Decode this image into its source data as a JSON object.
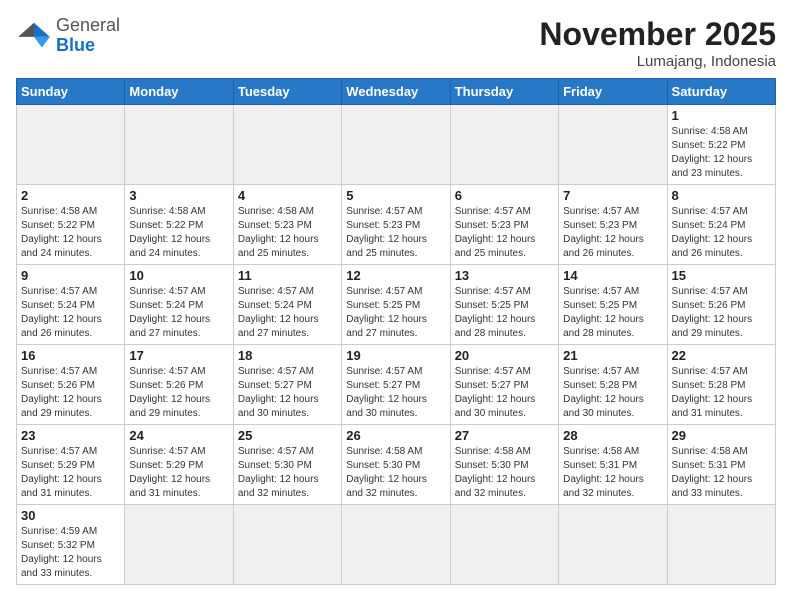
{
  "header": {
    "logo_general": "General",
    "logo_blue": "Blue",
    "month_title": "November 2025",
    "location": "Lumajang, Indonesia"
  },
  "weekdays": [
    "Sunday",
    "Monday",
    "Tuesday",
    "Wednesday",
    "Thursday",
    "Friday",
    "Saturday"
  ],
  "weeks": [
    [
      {
        "day": "",
        "info": ""
      },
      {
        "day": "",
        "info": ""
      },
      {
        "day": "",
        "info": ""
      },
      {
        "day": "",
        "info": ""
      },
      {
        "day": "",
        "info": ""
      },
      {
        "day": "",
        "info": ""
      },
      {
        "day": "1",
        "info": "Sunrise: 4:58 AM\nSunset: 5:22 PM\nDaylight: 12 hours\nand 23 minutes."
      }
    ],
    [
      {
        "day": "2",
        "info": "Sunrise: 4:58 AM\nSunset: 5:22 PM\nDaylight: 12 hours\nand 24 minutes."
      },
      {
        "day": "3",
        "info": "Sunrise: 4:58 AM\nSunset: 5:22 PM\nDaylight: 12 hours\nand 24 minutes."
      },
      {
        "day": "4",
        "info": "Sunrise: 4:58 AM\nSunset: 5:23 PM\nDaylight: 12 hours\nand 25 minutes."
      },
      {
        "day": "5",
        "info": "Sunrise: 4:57 AM\nSunset: 5:23 PM\nDaylight: 12 hours\nand 25 minutes."
      },
      {
        "day": "6",
        "info": "Sunrise: 4:57 AM\nSunset: 5:23 PM\nDaylight: 12 hours\nand 25 minutes."
      },
      {
        "day": "7",
        "info": "Sunrise: 4:57 AM\nSunset: 5:23 PM\nDaylight: 12 hours\nand 26 minutes."
      },
      {
        "day": "8",
        "info": "Sunrise: 4:57 AM\nSunset: 5:24 PM\nDaylight: 12 hours\nand 26 minutes."
      }
    ],
    [
      {
        "day": "9",
        "info": "Sunrise: 4:57 AM\nSunset: 5:24 PM\nDaylight: 12 hours\nand 26 minutes."
      },
      {
        "day": "10",
        "info": "Sunrise: 4:57 AM\nSunset: 5:24 PM\nDaylight: 12 hours\nand 27 minutes."
      },
      {
        "day": "11",
        "info": "Sunrise: 4:57 AM\nSunset: 5:24 PM\nDaylight: 12 hours\nand 27 minutes."
      },
      {
        "day": "12",
        "info": "Sunrise: 4:57 AM\nSunset: 5:25 PM\nDaylight: 12 hours\nand 27 minutes."
      },
      {
        "day": "13",
        "info": "Sunrise: 4:57 AM\nSunset: 5:25 PM\nDaylight: 12 hours\nand 28 minutes."
      },
      {
        "day": "14",
        "info": "Sunrise: 4:57 AM\nSunset: 5:25 PM\nDaylight: 12 hours\nand 28 minutes."
      },
      {
        "day": "15",
        "info": "Sunrise: 4:57 AM\nSunset: 5:26 PM\nDaylight: 12 hours\nand 29 minutes."
      }
    ],
    [
      {
        "day": "16",
        "info": "Sunrise: 4:57 AM\nSunset: 5:26 PM\nDaylight: 12 hours\nand 29 minutes."
      },
      {
        "day": "17",
        "info": "Sunrise: 4:57 AM\nSunset: 5:26 PM\nDaylight: 12 hours\nand 29 minutes."
      },
      {
        "day": "18",
        "info": "Sunrise: 4:57 AM\nSunset: 5:27 PM\nDaylight: 12 hours\nand 30 minutes."
      },
      {
        "day": "19",
        "info": "Sunrise: 4:57 AM\nSunset: 5:27 PM\nDaylight: 12 hours\nand 30 minutes."
      },
      {
        "day": "20",
        "info": "Sunrise: 4:57 AM\nSunset: 5:27 PM\nDaylight: 12 hours\nand 30 minutes."
      },
      {
        "day": "21",
        "info": "Sunrise: 4:57 AM\nSunset: 5:28 PM\nDaylight: 12 hours\nand 30 minutes."
      },
      {
        "day": "22",
        "info": "Sunrise: 4:57 AM\nSunset: 5:28 PM\nDaylight: 12 hours\nand 31 minutes."
      }
    ],
    [
      {
        "day": "23",
        "info": "Sunrise: 4:57 AM\nSunset: 5:29 PM\nDaylight: 12 hours\nand 31 minutes."
      },
      {
        "day": "24",
        "info": "Sunrise: 4:57 AM\nSunset: 5:29 PM\nDaylight: 12 hours\nand 31 minutes."
      },
      {
        "day": "25",
        "info": "Sunrise: 4:57 AM\nSunset: 5:30 PM\nDaylight: 12 hours\nand 32 minutes."
      },
      {
        "day": "26",
        "info": "Sunrise: 4:58 AM\nSunset: 5:30 PM\nDaylight: 12 hours\nand 32 minutes."
      },
      {
        "day": "27",
        "info": "Sunrise: 4:58 AM\nSunset: 5:30 PM\nDaylight: 12 hours\nand 32 minutes."
      },
      {
        "day": "28",
        "info": "Sunrise: 4:58 AM\nSunset: 5:31 PM\nDaylight: 12 hours\nand 32 minutes."
      },
      {
        "day": "29",
        "info": "Sunrise: 4:58 AM\nSunset: 5:31 PM\nDaylight: 12 hours\nand 33 minutes."
      }
    ],
    [
      {
        "day": "30",
        "info": "Sunrise: 4:59 AM\nSunset: 5:32 PM\nDaylight: 12 hours\nand 33 minutes."
      },
      {
        "day": "",
        "info": ""
      },
      {
        "day": "",
        "info": ""
      },
      {
        "day": "",
        "info": ""
      },
      {
        "day": "",
        "info": ""
      },
      {
        "day": "",
        "info": ""
      },
      {
        "day": "",
        "info": ""
      }
    ]
  ]
}
